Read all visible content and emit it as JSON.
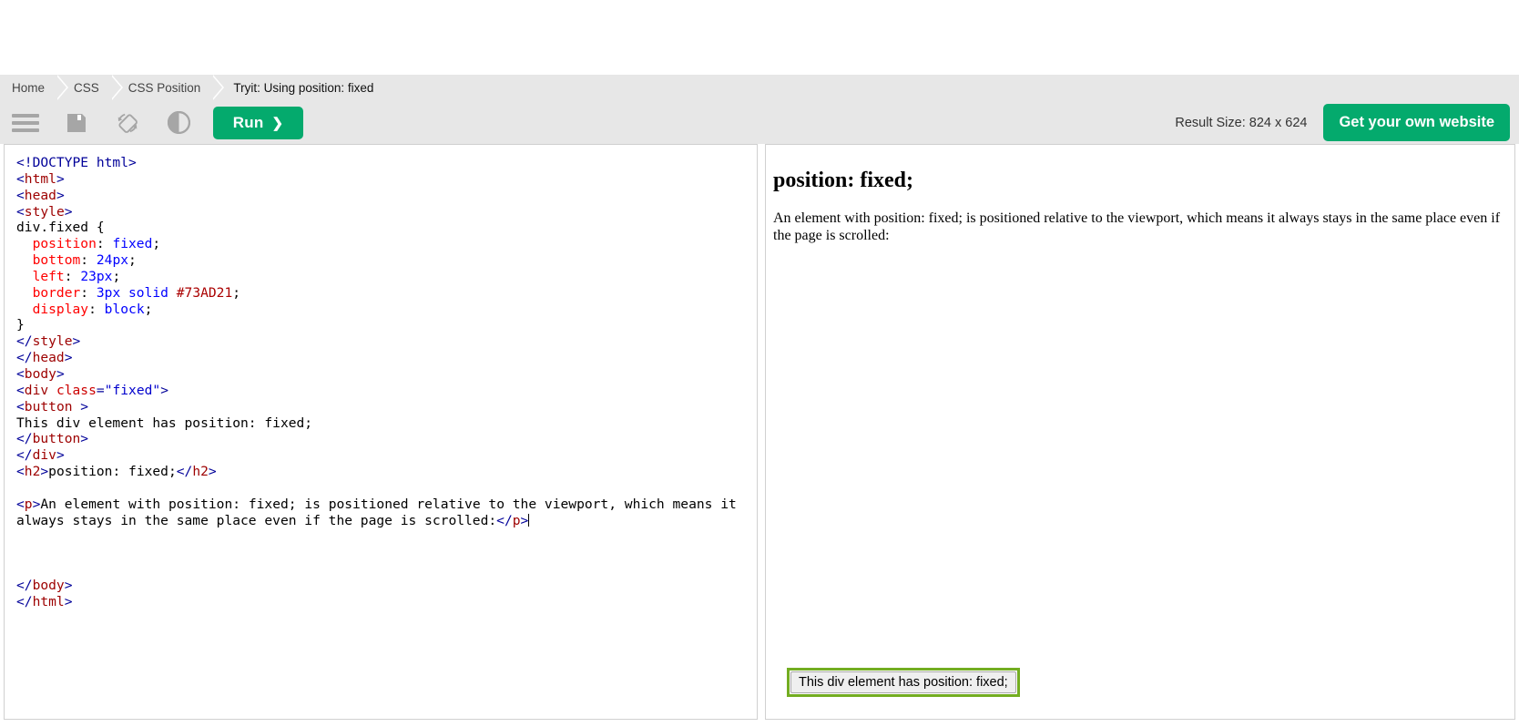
{
  "breadcrumb": {
    "items": [
      {
        "label": "Home"
      },
      {
        "label": "CSS"
      },
      {
        "label": "CSS Position"
      },
      {
        "label": "Tryit: Using position: fixed"
      }
    ]
  },
  "toolbar": {
    "menu_icon": "hamburger-menu-icon",
    "save_icon": "save-floppy-icon",
    "rotate_icon": "rotate-orientation-icon",
    "theme_icon": "dark-mode-contrast-icon",
    "run_label": "Run",
    "run_chevron": "❯",
    "result_size_label": "Result Size: 824 x 624",
    "get_website_label": "Get your own website",
    "accent_color": "#04AA6D"
  },
  "editor": {
    "lines": [
      {
        "parts": [
          {
            "t": "tag",
            "s": "<!DOCTYPE html>"
          }
        ]
      },
      {
        "parts": [
          {
            "t": "tag",
            "s": "<"
          },
          {
            "t": "tname",
            "s": "html"
          },
          {
            "t": "tag",
            "s": ">"
          }
        ]
      },
      {
        "parts": [
          {
            "t": "tag",
            "s": "<"
          },
          {
            "t": "tname",
            "s": "head"
          },
          {
            "t": "tag",
            "s": ">"
          }
        ]
      },
      {
        "parts": [
          {
            "t": "tag",
            "s": "<"
          },
          {
            "t": "tname",
            "s": "style"
          },
          {
            "t": "tag",
            "s": ">"
          }
        ]
      },
      {
        "parts": [
          {
            "t": "txt",
            "s": "div.fixed {"
          }
        ]
      },
      {
        "parts": [
          {
            "t": "txt",
            "s": "  "
          },
          {
            "t": "prop",
            "s": "position"
          },
          {
            "t": "txt",
            "s": ": "
          },
          {
            "t": "val",
            "s": "fixed"
          },
          {
            "t": "txt",
            "s": ";"
          }
        ]
      },
      {
        "parts": [
          {
            "t": "txt",
            "s": "  "
          },
          {
            "t": "prop",
            "s": "bottom"
          },
          {
            "t": "txt",
            "s": ": "
          },
          {
            "t": "val",
            "s": "24px"
          },
          {
            "t": "txt",
            "s": ";"
          }
        ]
      },
      {
        "parts": [
          {
            "t": "txt",
            "s": "  "
          },
          {
            "t": "prop",
            "s": "left"
          },
          {
            "t": "txt",
            "s": ": "
          },
          {
            "t": "val",
            "s": "23px"
          },
          {
            "t": "txt",
            "s": ";"
          }
        ]
      },
      {
        "parts": [
          {
            "t": "txt",
            "s": "  "
          },
          {
            "t": "prop",
            "s": "border"
          },
          {
            "t": "txt",
            "s": ": "
          },
          {
            "t": "val",
            "s": "3px solid "
          },
          {
            "t": "hexval",
            "s": "#73AD21"
          },
          {
            "t": "txt",
            "s": ";"
          }
        ]
      },
      {
        "parts": [
          {
            "t": "txt",
            "s": "  "
          },
          {
            "t": "prop",
            "s": "display"
          },
          {
            "t": "txt",
            "s": ": "
          },
          {
            "t": "val",
            "s": "block"
          },
          {
            "t": "txt",
            "s": ";"
          }
        ]
      },
      {
        "parts": [
          {
            "t": "txt",
            "s": "}"
          }
        ]
      },
      {
        "parts": [
          {
            "t": "tag",
            "s": "</"
          },
          {
            "t": "tname",
            "s": "style"
          },
          {
            "t": "tag",
            "s": ">"
          }
        ]
      },
      {
        "parts": [
          {
            "t": "tag",
            "s": "</"
          },
          {
            "t": "tname",
            "s": "head"
          },
          {
            "t": "tag",
            "s": ">"
          }
        ]
      },
      {
        "parts": [
          {
            "t": "tag",
            "s": "<"
          },
          {
            "t": "tname",
            "s": "body"
          },
          {
            "t": "tag",
            "s": ">"
          }
        ]
      },
      {
        "parts": [
          {
            "t": "tag",
            "s": "<"
          },
          {
            "t": "tname",
            "s": "div"
          },
          {
            "t": "txt",
            "s": " "
          },
          {
            "t": "attr",
            "s": "class"
          },
          {
            "t": "tag",
            "s": "="
          },
          {
            "t": "aval",
            "s": "\"fixed\""
          },
          {
            "t": "tag",
            "s": ">"
          }
        ]
      },
      {
        "parts": [
          {
            "t": "tag",
            "s": "<"
          },
          {
            "t": "tname",
            "s": "button"
          },
          {
            "t": "tag",
            "s": " >"
          }
        ]
      },
      {
        "parts": [
          {
            "t": "txt",
            "s": "This div element has position: fixed;"
          }
        ]
      },
      {
        "parts": [
          {
            "t": "tag",
            "s": "</"
          },
          {
            "t": "tname",
            "s": "button"
          },
          {
            "t": "tag",
            "s": ">"
          }
        ]
      },
      {
        "parts": [
          {
            "t": "tag",
            "s": "</"
          },
          {
            "t": "tname",
            "s": "div"
          },
          {
            "t": "tag",
            "s": ">"
          }
        ]
      },
      {
        "parts": [
          {
            "t": "tag",
            "s": "<"
          },
          {
            "t": "tname",
            "s": "h2"
          },
          {
            "t": "tag",
            "s": ">"
          },
          {
            "t": "txt",
            "s": "position: fixed;"
          },
          {
            "t": "tag",
            "s": "</"
          },
          {
            "t": "tname",
            "s": "h2"
          },
          {
            "t": "tag",
            "s": ">"
          }
        ]
      },
      {
        "parts": [
          {
            "t": "txt",
            "s": ""
          }
        ]
      },
      {
        "parts": [
          {
            "t": "tag",
            "s": "<"
          },
          {
            "t": "tname",
            "s": "p"
          },
          {
            "t": "tag",
            "s": ">"
          },
          {
            "t": "txt",
            "s": "An element with position: fixed; is positioned relative to the viewport, which means it always stays in the same place even if the page is scrolled:"
          },
          {
            "t": "tag",
            "s": "</"
          },
          {
            "t": "tname",
            "s": "p"
          },
          {
            "t": "tag",
            "s": ">"
          },
          {
            "t": "caret",
            "s": ""
          }
        ]
      },
      {
        "parts": [
          {
            "t": "txt",
            "s": ""
          }
        ]
      },
      {
        "parts": [
          {
            "t": "txt",
            "s": ""
          }
        ]
      },
      {
        "parts": [
          {
            "t": "txt",
            "s": ""
          }
        ]
      },
      {
        "parts": [
          {
            "t": "tag",
            "s": "</"
          },
          {
            "t": "tname",
            "s": "body"
          },
          {
            "t": "tag",
            "s": ">"
          }
        ]
      },
      {
        "parts": [
          {
            "t": "tag",
            "s": "</"
          },
          {
            "t": "tname",
            "s": "html"
          },
          {
            "t": "tag",
            "s": ">"
          }
        ]
      }
    ]
  },
  "result": {
    "heading": "position: fixed;",
    "paragraph": "An element with position: fixed; is positioned relative to the viewport, which means it always stays in the same place even if the page is scrolled:",
    "fixed_button_label": "This div element has position: fixed;",
    "fixed_border_color": "#73AD21"
  }
}
